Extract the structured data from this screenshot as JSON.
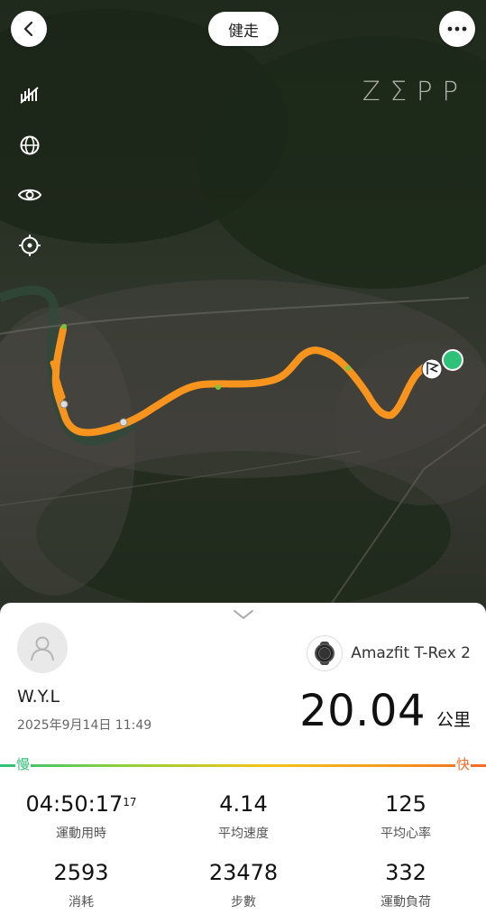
{
  "header": {
    "title": "健走",
    "logo_text": "ZΣPP"
  },
  "map_tools": [
    {
      "icon": "satellite-signal-off-icon"
    },
    {
      "icon": "globe-icon"
    },
    {
      "icon": "eye-icon"
    },
    {
      "icon": "locate-target-icon"
    }
  ],
  "colors": {
    "route": "#f7941d",
    "start_marker": "#2ec178",
    "pace_slow": "#2ec178",
    "pace_fast": "#f26b28"
  },
  "user": {
    "name": "W.Y.L",
    "date": "2025年9月14日 11:49"
  },
  "device": {
    "name": "Amazfit T-Rex 2"
  },
  "distance": {
    "value": "20.04",
    "unit": "公里"
  },
  "pace_scale": {
    "slow_label": "慢",
    "fast_label": "快"
  },
  "stats": {
    "duration": {
      "value": "04:50:17",
      "fraction": "17",
      "label": "運動用時"
    },
    "avg_speed": {
      "value": "4.14",
      "label": "平均速度"
    },
    "avg_hr": {
      "value": "125",
      "label": "平均心率"
    },
    "calories": {
      "value": "2593",
      "label": "消耗"
    },
    "steps": {
      "value": "23478",
      "label": "步數"
    },
    "load": {
      "value": "332",
      "label": "運動負荷"
    }
  }
}
